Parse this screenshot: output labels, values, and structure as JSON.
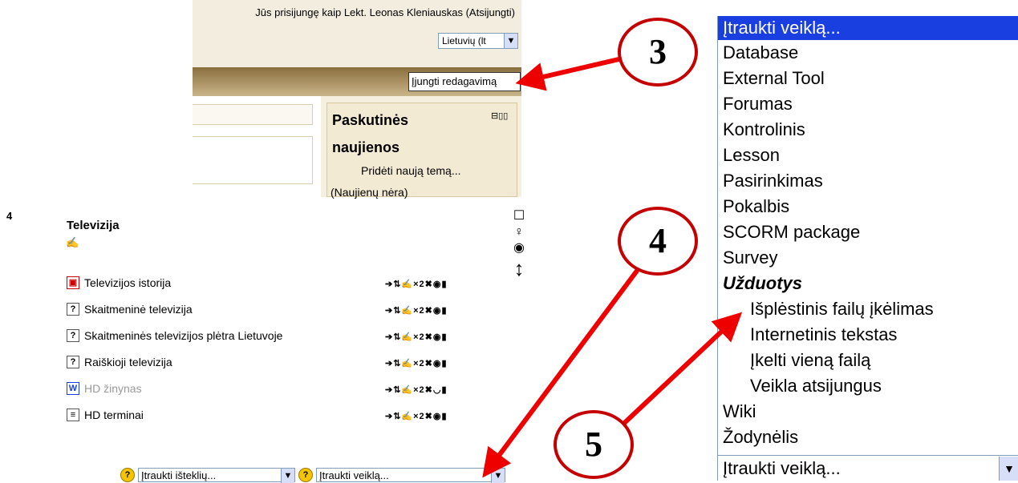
{
  "header": {
    "login_text": "Jūs prisijungę kaip Lekt. Leonas Kleniauskas (Atsijungti)",
    "language_select": "Lietuvių (lt",
    "edit_button": "Įjungti redagavimą"
  },
  "news_block": {
    "title_line1": "Paskutinės",
    "title_line2": "naujienos",
    "add_topic": "Pridėti naują temą...",
    "no_news": "(Naujienų nėra)"
  },
  "section": {
    "number": "4",
    "title": "Televizija",
    "resources": [
      {
        "label": "Televizijos istorija",
        "icon": "presentation-icon"
      },
      {
        "label": "Skaitmeninė televizija",
        "icon": "question-icon"
      },
      {
        "label": "Skaitmeninės televizijos plėtra Lietuvoje",
        "icon": "question-icon"
      },
      {
        "label": "Raiškioji televizija",
        "icon": "question-icon"
      },
      {
        "label": "HD žinynas",
        "icon": "word-doc-icon",
        "hidden": true
      },
      {
        "label": "HD terminai",
        "icon": "text-doc-icon"
      }
    ],
    "add_resource_select": "Įtraukti išteklių...",
    "add_activity_select": "Įtraukti veiklą..."
  },
  "activity_dropdown": {
    "selected": "Įtraukti veiklą...",
    "items": [
      "Database",
      "External Tool",
      "Forumas",
      "Kontrolinis",
      "Lesson",
      "Pasirinkimas",
      "Pokalbis",
      "SCORM package",
      "Survey"
    ],
    "group_label": "Užduotys",
    "group_items": [
      "Išplėstinis failų įkėlimas",
      "Internetinis tekstas",
      "Įkelti vieną failą",
      "Veikla atsijungus"
    ],
    "items_after": [
      "Wiki",
      "Žodynėlis"
    ],
    "bottom_value": "Įtraukti veiklą..."
  },
  "callouts": [
    "3",
    "4",
    "5"
  ],
  "colors": {
    "callout": "#c40000",
    "selection": "#1a3fe0",
    "navbar": "#8a6e3e"
  }
}
